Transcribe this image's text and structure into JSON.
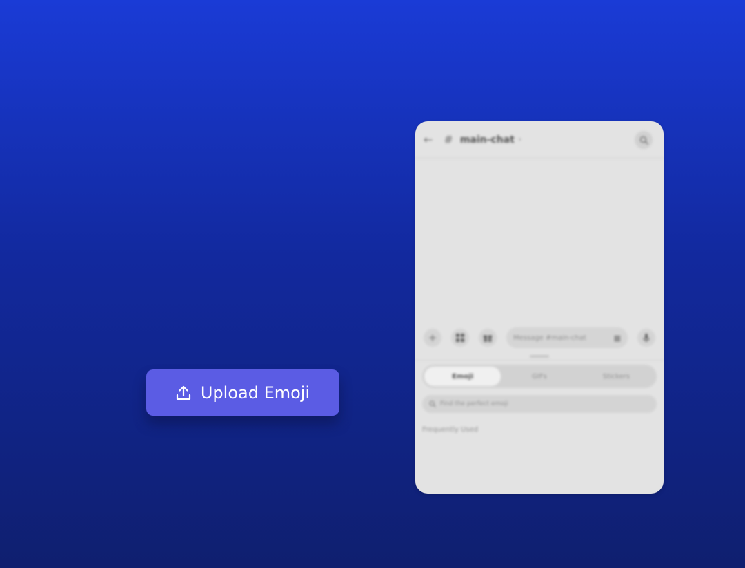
{
  "upload": {
    "label": "Upload Emoji",
    "icon": "upload-icon",
    "color": "#5b5ce4"
  },
  "phone": {
    "header": {
      "back_icon": "arrow-left-icon",
      "hash_icon": "hash-icon",
      "channel_name": "main-chat",
      "chevron": "›",
      "search_icon": "search-icon"
    },
    "composer": {
      "plus_icon": "+",
      "apps_icon": "apps-icon",
      "gift_icon": "gift-icon",
      "placeholder": "Message #main-chat",
      "keyboard_icon": "▦",
      "mic_icon": "mic-icon"
    },
    "tabs": [
      {
        "label": "Emoji",
        "active": true
      },
      {
        "label": "GIFs",
        "active": false
      },
      {
        "label": "Stickers",
        "active": false
      }
    ],
    "emoji_search_placeholder": "Find the perfect emoji",
    "section_label": "Frequently Used"
  },
  "colors": {
    "background_top": "#1a3bd6",
    "background_bottom": "#0f1f6f",
    "panel": "#e3e3e3"
  }
}
